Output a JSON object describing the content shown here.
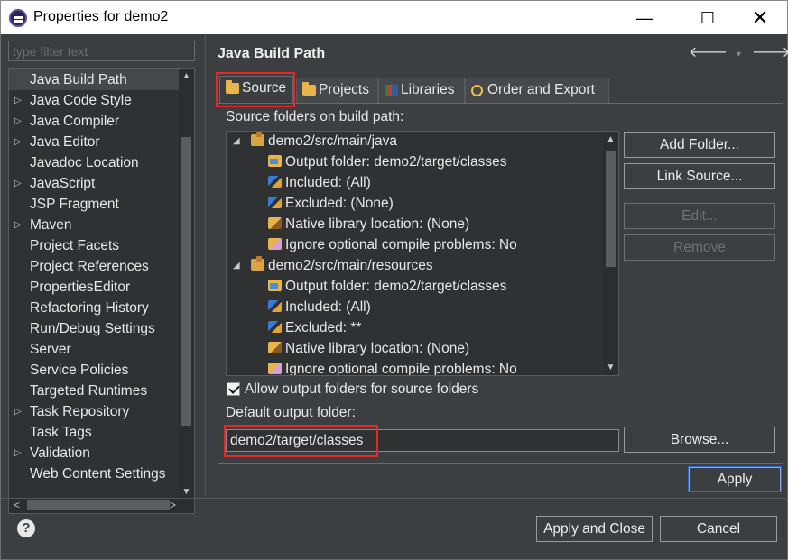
{
  "window": {
    "title": "Properties for demo2",
    "minimize": "—",
    "maximize": "☐",
    "close": "✕"
  },
  "filter": {
    "placeholder": "type filter text"
  },
  "nav": {
    "items": [
      {
        "label": "Java Build Path",
        "expandable": false,
        "selected": true
      },
      {
        "label": "Java Code Style",
        "expandable": true
      },
      {
        "label": "Java Compiler",
        "expandable": true
      },
      {
        "label": "Java Editor",
        "expandable": true
      },
      {
        "label": "Javadoc Location",
        "expandable": false
      },
      {
        "label": "JavaScript",
        "expandable": true
      },
      {
        "label": "JSP Fragment",
        "expandable": false
      },
      {
        "label": "Maven",
        "expandable": true
      },
      {
        "label": "Project Facets",
        "expandable": false
      },
      {
        "label": "Project References",
        "expandable": false
      },
      {
        "label": "PropertiesEditor",
        "expandable": false
      },
      {
        "label": "Refactoring History",
        "expandable": false
      },
      {
        "label": "Run/Debug Settings",
        "expandable": false
      },
      {
        "label": "Server",
        "expandable": false
      },
      {
        "label": "Service Policies",
        "expandable": false
      },
      {
        "label": "Targeted Runtimes",
        "expandable": false
      },
      {
        "label": "Task Repository",
        "expandable": true
      },
      {
        "label": "Task Tags",
        "expandable": false
      },
      {
        "label": "Validation",
        "expandable": true
      },
      {
        "label": "Web Content Settings",
        "expandable": false
      }
    ]
  },
  "pane": {
    "title": "Java Build Path",
    "nav_back": "🡐",
    "nav_forward": "🡒",
    "tabs": [
      {
        "label": "Source",
        "icon": "source-folder-icon",
        "active": true
      },
      {
        "label": "Projects",
        "icon": "projects-folder-icon"
      },
      {
        "label": "Libraries",
        "icon": "libraries-icon"
      },
      {
        "label": "Order and Export",
        "icon": "order-export-icon"
      }
    ],
    "source_folders_label": "Source folders on build path:",
    "tree": [
      {
        "label": "demo2/src/main/java",
        "level": 0,
        "icon": "package-folder-icon",
        "expanded": true
      },
      {
        "label": "Output folder: demo2/target/classes",
        "level": 1,
        "icon": "output-folder-icon"
      },
      {
        "label": "Included: (All)",
        "level": 1,
        "icon": "inclusion-filter-icon"
      },
      {
        "label": "Excluded: (None)",
        "level": 1,
        "icon": "exclusion-filter-icon"
      },
      {
        "label": "Native library location: (None)",
        "level": 1,
        "icon": "native-library-icon"
      },
      {
        "label": "Ignore optional compile problems: No",
        "level": 1,
        "icon": "ignore-problems-icon"
      },
      {
        "label": "demo2/src/main/resources",
        "level": 0,
        "icon": "package-folder-icon",
        "expanded": true
      },
      {
        "label": "Output folder: demo2/target/classes",
        "level": 1,
        "icon": "output-folder-icon"
      },
      {
        "label": "Included: (All)",
        "level": 1,
        "icon": "inclusion-filter-icon"
      },
      {
        "label": "Excluded: **",
        "level": 1,
        "icon": "exclusion-filter-icon"
      },
      {
        "label": "Native library location: (None)",
        "level": 1,
        "icon": "native-library-icon"
      },
      {
        "label": "Ignore optional compile problems: No",
        "level": 1,
        "icon": "ignore-problems-icon"
      }
    ],
    "buttons": {
      "add_folder": "Add Folder...",
      "link_source": "Link Source...",
      "edit": "Edit...",
      "remove": "Remove"
    },
    "allow_output_folders": {
      "label": "Allow output folders for source folders",
      "checked": true
    },
    "default_output_label": "Default output folder:",
    "default_output_value": "demo2/target/classes",
    "browse": "Browse...",
    "apply": "Apply"
  },
  "footer": {
    "help": "?",
    "apply_and_close": "Apply and Close",
    "cancel": "Cancel"
  },
  "colors": {
    "highlight_box": "#e12b2b",
    "dialog_bg": "#3c3f41",
    "tree_bg": "#2f3133"
  }
}
